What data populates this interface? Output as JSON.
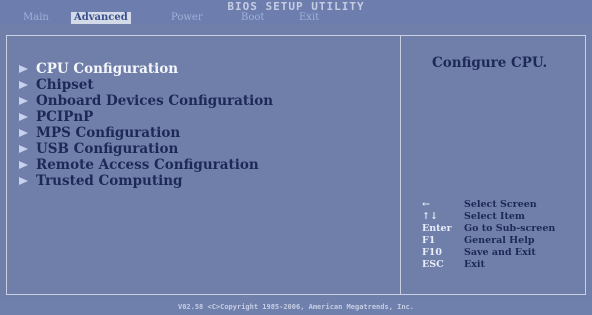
{
  "header": {
    "title": "BIOS SETUP UTILITY",
    "tabs": [
      {
        "label": "Main"
      },
      {
        "label": "Advanced"
      },
      {
        "label": "Power"
      },
      {
        "label": "Boot"
      },
      {
        "label": "Exit"
      }
    ],
    "active_tab": "Advanced"
  },
  "menu": {
    "items": [
      {
        "label": "CPU Configuration",
        "selected": true,
        "icon": "submenu-arrow-icon"
      },
      {
        "label": "Chipset",
        "selected": false,
        "icon": "submenu-arrow-icon"
      },
      {
        "label": "Onboard Devices Configuration",
        "selected": false,
        "icon": "submenu-arrow-icon"
      },
      {
        "label": "PCIPnP",
        "selected": false,
        "icon": "submenu-arrow-icon"
      },
      {
        "label": "MPS Configuration",
        "selected": false,
        "icon": "submenu-arrow-icon"
      },
      {
        "label": "USB Configuration",
        "selected": false,
        "icon": "submenu-arrow-icon"
      },
      {
        "label": "Remote Access Configuration",
        "selected": false,
        "icon": "submenu-arrow-icon"
      },
      {
        "label": "Trusted Computing",
        "selected": false,
        "icon": "submenu-arrow-icon"
      }
    ]
  },
  "help": {
    "text": "Configure CPU.",
    "keys": [
      {
        "key": "←",
        "desc": "Select Screen"
      },
      {
        "key": "↑↓",
        "desc": "Select Item"
      },
      {
        "key": "Enter",
        "desc": "Go to Sub-screen"
      },
      {
        "key": "F1",
        "desc": "General Help"
      },
      {
        "key": "F10",
        "desc": "Save and Exit"
      },
      {
        "key": "ESC",
        "desc": "Exit"
      }
    ]
  },
  "footer": {
    "text": "V02.58 <C>Copyright 1985-2006, American Megatrends, Inc."
  },
  "colors": {
    "background": "#6f7fa9",
    "text_dark": "#1e2858",
    "text_highlight": "#f4f6fb",
    "active_tab_bg": "#d4dbe8"
  }
}
